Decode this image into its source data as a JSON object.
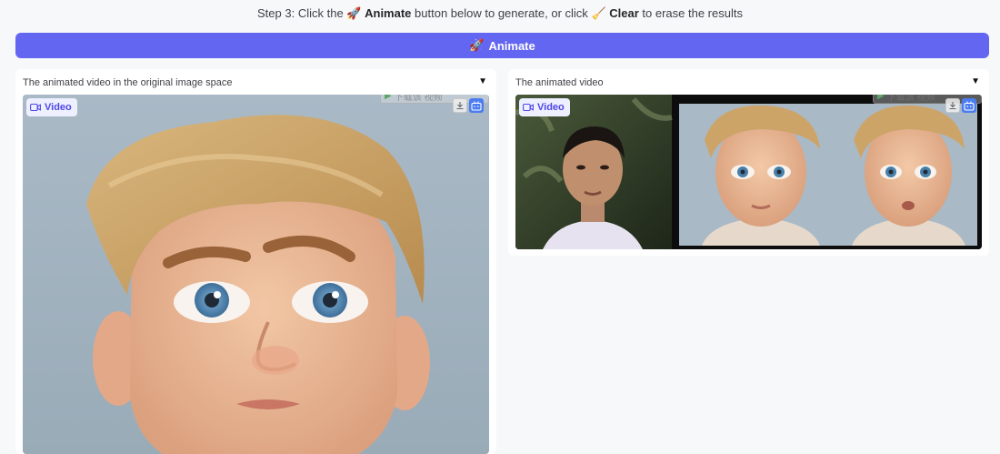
{
  "instructions": {
    "prefix": "Step 3: Click the",
    "animate_emoji": "🚀",
    "animate_word": "Animate",
    "middle": "button below to generate, or click",
    "clear_emoji": "🧹",
    "clear_word": "Clear",
    "suffix": "to erase the results"
  },
  "animate_button": {
    "emoji": "🚀",
    "label": "Animate"
  },
  "left_panel": {
    "title": "The animated video in the original image space",
    "badge": "Video",
    "watermark": "下载该 视频"
  },
  "right_panel": {
    "title": "The animated video",
    "badge": "Video",
    "watermark": "下载该 视频"
  },
  "icons": {
    "collapse": "caret-down-icon",
    "video": "video-camera-icon",
    "download": "download-icon",
    "bilibili": "bilibili-tv-icon"
  },
  "colors": {
    "accent": "#6366f1",
    "badge_text": "#4f46e5"
  }
}
